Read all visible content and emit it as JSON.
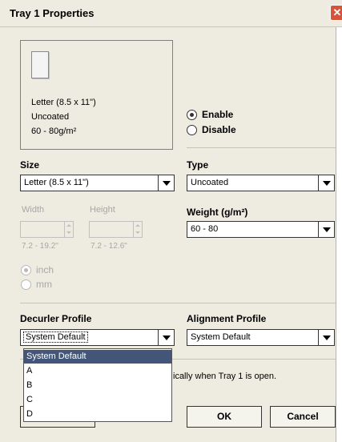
{
  "window": {
    "title": "Tray 1 Properties",
    "close_glyph": "✕"
  },
  "preview": {
    "size_text": "Letter (8.5 x 11\")",
    "type_text": "Uncoated",
    "weight_text": "60 - 80g/m²"
  },
  "state": {
    "enable_label": "Enable",
    "disable_label": "Disable",
    "selected": "Enable"
  },
  "size": {
    "label": "Size",
    "value": "Letter (8.5 x 11\")",
    "width_label": "Width",
    "height_label": "Height",
    "width_range": "7.2 - 19.2\"",
    "height_range": "7.2 - 12.6\"",
    "unit_inch": "inch",
    "unit_mm": "mm",
    "unit_selected": "inch"
  },
  "type": {
    "label": "Type",
    "value": "Uncoated"
  },
  "weight": {
    "label": "Weight (g/m²)",
    "value": "60 - 80"
  },
  "decurler": {
    "label": "Decurler Profile",
    "value": "System Default",
    "options": [
      "System Default",
      "A",
      "B",
      "C",
      "D"
    ],
    "highlighted": "System Default"
  },
  "alignment": {
    "label": "Alignment Profile",
    "value": "System Default"
  },
  "info": {
    "text": "ically when Tray 1 is open."
  },
  "buttons": {
    "ok": "OK",
    "cancel": "Cancel"
  },
  "colors": {
    "dialog_bg": "#eeece1",
    "highlight": "#44557a",
    "close_red": "#d6543a"
  }
}
